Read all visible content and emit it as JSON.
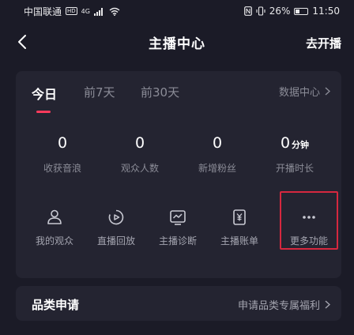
{
  "status_bar": {
    "carrier": "中国联通",
    "hd": "HD",
    "network": "4G",
    "battery": "26%",
    "time": "11:50"
  },
  "nav": {
    "title": "主播中心",
    "go_live": "去开播"
  },
  "tabs": [
    {
      "label": "今日",
      "active": true
    },
    {
      "label": "前7天",
      "active": false
    },
    {
      "label": "前30天",
      "active": false
    }
  ],
  "data_center": "数据中心",
  "stats": [
    {
      "value": "0",
      "unit": "",
      "label": "收获音浪"
    },
    {
      "value": "0",
      "unit": "",
      "label": "观众人数"
    },
    {
      "value": "0",
      "unit": "",
      "label": "新增粉丝"
    },
    {
      "value": "0",
      "unit": "分钟",
      "label": "开播时长"
    }
  ],
  "functions": [
    {
      "label": "我的观众",
      "icon": "audience-icon"
    },
    {
      "label": "直播回放",
      "icon": "replay-icon"
    },
    {
      "label": "主播诊断",
      "icon": "diagnosis-icon"
    },
    {
      "label": "主播账单",
      "icon": "bill-icon"
    },
    {
      "label": "更多功能",
      "icon": "more-icon"
    }
  ],
  "category": {
    "title": "品类申请",
    "link": "申请品类专属福利"
  },
  "colors": {
    "background": "#1b1b27",
    "card": "#242431",
    "accent": "#ff3b5c",
    "highlight": "#d6283f"
  }
}
